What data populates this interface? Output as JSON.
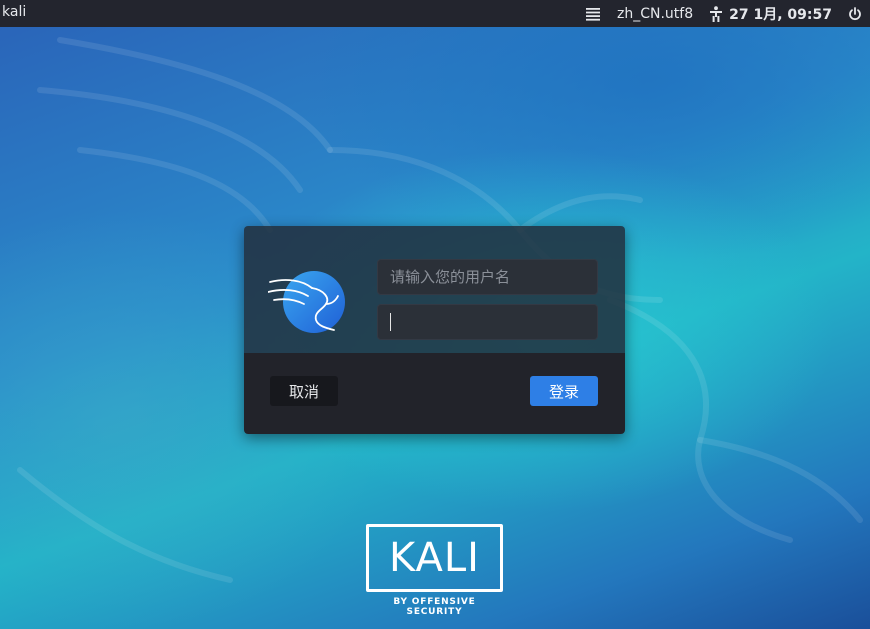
{
  "topbar": {
    "hostname": "kali",
    "locale": "zh_CN.utf8",
    "clock": "27 1月, 09:57",
    "icons": [
      "menu-lines-icon",
      "accessibility-icon",
      "power-icon"
    ]
  },
  "login": {
    "username_placeholder": "请输入您的用户名",
    "username_value": "",
    "password_value": "",
    "cancel_label": "取消",
    "login_label": "登录"
  },
  "brand": {
    "title": "KALI",
    "subtitle": "BY OFFENSIVE SECURITY"
  },
  "colors": {
    "topbar_bg": "#23252e",
    "dialog_bg": "#222e3c",
    "dialog_footer_bg": "#22232a",
    "accent": "#2e7fe6"
  }
}
